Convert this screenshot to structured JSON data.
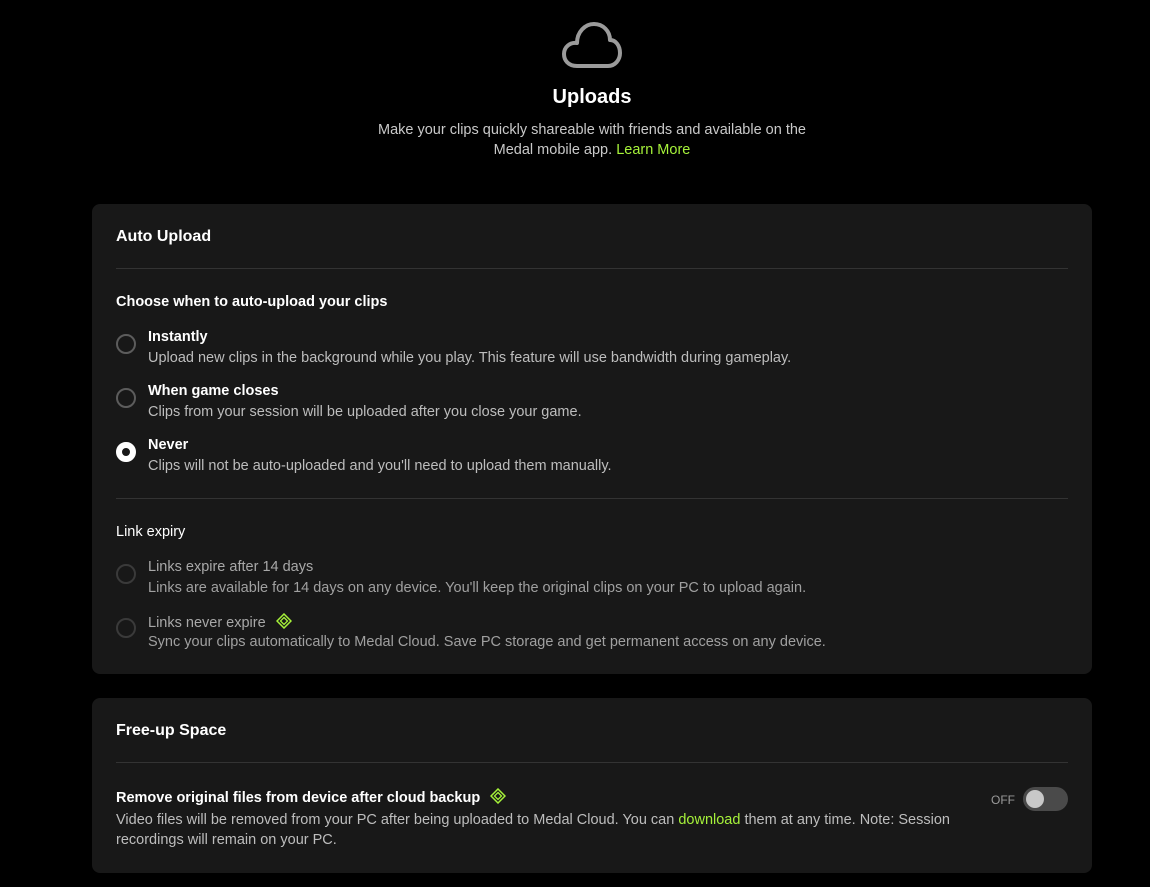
{
  "header": {
    "icon": "cloud-icon",
    "title": "Uploads",
    "subtitle": "Make your clips quickly shareable with friends and available on the Medal mobile app.",
    "learn_more": "Learn More"
  },
  "colors": {
    "accent": "#a6f23a",
    "card_bg": "#181818",
    "page_bg": "#000000"
  },
  "auto_upload": {
    "title": "Auto Upload",
    "choose_label": "Choose when to auto-upload your clips",
    "options": [
      {
        "title": "Instantly",
        "description": "Upload new clips in the background while you play. This feature will use bandwidth during gameplay.",
        "selected": false
      },
      {
        "title": "When game closes",
        "description": "Clips from your session will be uploaded after you close your game.",
        "selected": false
      },
      {
        "title": "Never",
        "description": "Clips will not be auto-uploaded and you'll need to upload them manually.",
        "selected": true
      }
    ],
    "link_expiry": {
      "label": "Link expiry",
      "options": [
        {
          "title": "Links expire after 14 days",
          "description": "Links are available for 14 days on any device. You'll keep the original clips on your PC to upload again.",
          "premium_icon": false
        },
        {
          "title": "Links never expire",
          "description": "Sync your clips automatically to Medal Cloud. Save PC storage and get permanent access on any device.",
          "premium_icon": true
        }
      ]
    }
  },
  "free_up_space": {
    "title": "Free-up Space",
    "row_title": "Remove original files from device after cloud backup",
    "desc_before": "Video files will be removed from your PC after being uploaded to Medal Cloud. You can ",
    "desc_link": "download",
    "desc_after": " them at any time. Note: Session recordings will remain on your PC.",
    "toggle_state_label": "OFF",
    "toggle_on": false
  }
}
